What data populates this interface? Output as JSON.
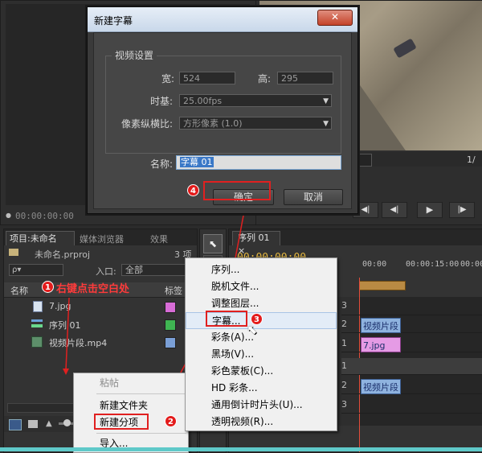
{
  "dialog": {
    "title": "新建字幕",
    "close": "✕",
    "group_title": "视频设置",
    "width_label": "宽:",
    "width_value": "524",
    "height_label": "高:",
    "height_value": "295",
    "timebase_label": "时基:",
    "timebase_value": "25.00fps",
    "aspect_label": "像素纵横比:",
    "aspect_value": "方形像素 (1.0)",
    "name_label": "名称:",
    "name_value": "字幕 01",
    "ok": "确定",
    "cancel": "取消",
    "step": "4"
  },
  "source_monitor": {
    "timecode": "00:00:00:00"
  },
  "project_panel": {
    "tabs": [
      "项目:未命名",
      "媒体浏览器",
      "效果"
    ],
    "file": "未命名.prproj",
    "count": "3 项",
    "search_placeholder": "ρ▾",
    "inlet_label": "入口:",
    "inlet_value": "全部",
    "col_name": "名称",
    "col_label": "标签",
    "annotation": "右键点击空白处",
    "step": "1",
    "items": [
      {
        "name": "7.jpg",
        "color": "#d76cd6",
        "icon": "image-icon"
      },
      {
        "name": "序列 01",
        "color": "#3fb552",
        "icon": "sequence-icon"
      },
      {
        "name": "视频片段.mp4",
        "color": "#7a9fd6",
        "icon": "video-icon"
      }
    ]
  },
  "context_menu_1": {
    "items": [
      "粘帖",
      "新建文件夹",
      "新建分项",
      "导入..."
    ],
    "step": "2"
  },
  "context_menu_2": {
    "items": [
      "序列...",
      "脱机文件...",
      "调整图层...",
      "字幕...",
      "彩条(A)...",
      "黑场(V)...",
      "彩色蒙板(C)...",
      "HD 彩条...",
      "通用倒计时片头(U)...",
      "透明视频(R)..."
    ],
    "step": "3"
  },
  "timeline": {
    "tab": "序列 01",
    "timecode": "00:00:00:00",
    "ruler": [
      "00:00",
      "00:00:15:00",
      "00:00"
    ],
    "tracks": [
      "3",
      "2",
      "1",
      "1",
      "2",
      "3"
    ],
    "clips": [
      {
        "label": "视频片段",
        "track": 1
      },
      {
        "label": "7.jpg",
        "track": 2
      },
      {
        "label": "视频片段",
        "track": 4
      }
    ]
  },
  "program_monitor": {
    "zoom": "1/"
  }
}
